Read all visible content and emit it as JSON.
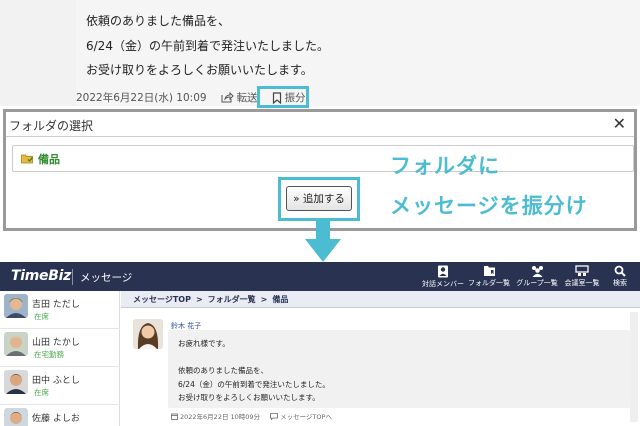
{
  "top_message": {
    "lines": [
      "依頼のありました備品を、",
      "6/24（金）の午前到着で発注いたしました。",
      "お受け取りをよろしくお願いいたします。"
    ],
    "timestamp": "2022年6月22日(水) 10:09",
    "forward_label": "転送",
    "sort_label": "振分"
  },
  "dialog": {
    "title": "フォルダの選択",
    "close_symbol": "✕",
    "folder_name": "備品",
    "add_button_label": "» 追加する"
  },
  "annotation": {
    "line1": "フォルダに",
    "line2": "メッセージを振分け"
  },
  "app": {
    "logo": "TimeBiz",
    "section_title": "メッセージ",
    "nav": [
      {
        "label": "対話メンバー",
        "icon": "person-icon"
      },
      {
        "label": "フォルダ一覧",
        "icon": "folder-icon"
      },
      {
        "label": "グループ一覧",
        "icon": "group-icon"
      },
      {
        "label": "会議室一覧",
        "icon": "meeting-room-icon"
      },
      {
        "label": "検索",
        "icon": "search-icon"
      }
    ],
    "contacts": [
      {
        "name": "吉田 ただし",
        "status": "在席"
      },
      {
        "name": "山田 たかし",
        "status": "在宅勤務"
      },
      {
        "name": "田中 ふとし",
        "status": "在席"
      },
      {
        "name": "佐藤 よしお",
        "status": ""
      }
    ],
    "breadcrumb": [
      "メッセージTOP",
      "フォルダ一覧",
      "備品"
    ],
    "breadcrumb_sep": ">",
    "message": {
      "sender": "鈴木 花子",
      "lines": [
        "お疲れ様です。",
        "",
        "依頼のありました備品を、",
        "6/24（金）の午前到着で発注いたしました。",
        "お受け取りをよろしくお願いいたします。"
      ],
      "timestamp": "2022年6月22日 10時09分",
      "back_label": "メッセージTOPへ"
    }
  },
  "colors": {
    "accent": "#4bbcd2",
    "header": "#2a3252",
    "folder_green": "#2e8b2e",
    "link_blue": "#2a4ba8"
  }
}
